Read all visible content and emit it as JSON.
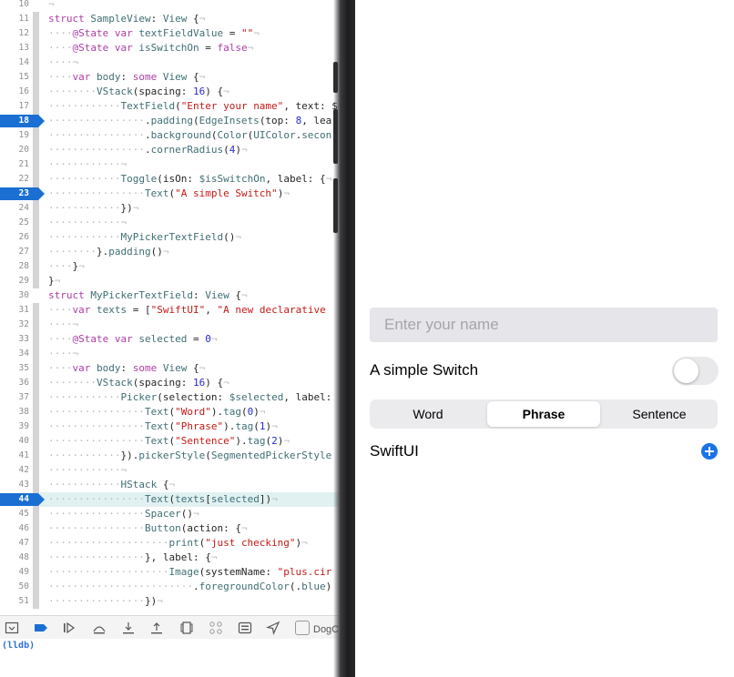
{
  "editor": {
    "lines": [
      {
        "num": "10",
        "html": "<span class='ws'>¬</span>"
      },
      {
        "num": "11",
        "html": "<span class='kw'>struct</span> <span class='ty'>SampleView</span>: <span class='ty'>View</span> {<span class='ws'>¬</span>"
      },
      {
        "num": "12",
        "html": "<span class='ws'>····</span><span class='kw'>@State</span> <span class='kw'>var</span> <span class='ty'>textFieldValue</span> = <span class='st'>\"\"</span><span class='ws'>¬</span>"
      },
      {
        "num": "13",
        "html": "<span class='ws'>····</span><span class='kw'>@State</span> <span class='kw'>var</span> <span class='ty'>isSwitchOn</span> = <span class='kw'>false</span><span class='ws'>¬</span>"
      },
      {
        "num": "14",
        "html": "<span class='ws'>····¬</span>"
      },
      {
        "num": "15",
        "html": "<span class='ws'>····</span><span class='kw'>var</span> <span class='ty'>body</span>: <span class='kw'>some</span> <span class='ty'>View</span> {<span class='ws'>¬</span>"
      },
      {
        "num": "16",
        "html": "<span class='ws'>········</span><span class='ty'>VStack</span>(spacing: <span class='nm'>16</span>) {<span class='ws'>¬</span>"
      },
      {
        "num": "17",
        "html": "<span class='ws'>············</span><span class='ty'>TextField</span>(<span class='st'>\"Enter your name\"</span>, text: $"
      },
      {
        "num": "18",
        "bp": true,
        "html": "<span class='ws'>················</span>.<span class='ty'>padding</span>(<span class='ty'>EdgeInsets</span>(top: <span class='nm'>8</span>, lea"
      },
      {
        "num": "19",
        "html": "<span class='ws'>················</span>.<span class='ty'>background</span>(<span class='ty'>Color</span>(<span class='ty'>UIColor</span>.<span class='ty'>secon</span>"
      },
      {
        "num": "20",
        "html": "<span class='ws'>················</span>.<span class='ty'>cornerRadius</span>(<span class='nm'>4</span>)<span class='ws'>¬</span>"
      },
      {
        "num": "21",
        "html": "<span class='ws'>············¬</span>"
      },
      {
        "num": "22",
        "html": "<span class='ws'>············</span><span class='ty'>Toggle</span>(isOn: <span class='ty'>$isSwitchOn</span>, label: {<span class='ws'>¬</span>"
      },
      {
        "num": "23",
        "bp": true,
        "html": "<span class='ws'>················</span><span class='ty'>Text</span>(<span class='st'>\"A simple Switch\"</span>)<span class='ws'>¬</span>"
      },
      {
        "num": "24",
        "html": "<span class='ws'>············</span>})<span class='ws'>¬</span>"
      },
      {
        "num": "25",
        "html": "<span class='ws'>············¬</span>"
      },
      {
        "num": "26",
        "html": "<span class='ws'>············</span><span class='ty'>MyPickerTextField</span>()<span class='ws'>¬</span>"
      },
      {
        "num": "27",
        "html": "<span class='ws'>········</span>}.<span class='ty'>padding</span>()<span class='ws'>¬</span>"
      },
      {
        "num": "28",
        "html": "<span class='ws'>····</span>}<span class='ws'>¬</span>"
      },
      {
        "num": "29",
        "html": "}<span class='ws'>¬</span>"
      },
      {
        "num": "30",
        "html": "<span class='kw'>struct</span> <span class='ty'>MyPickerTextField</span>: <span class='ty'>View</span> {<span class='ws'>¬</span>"
      },
      {
        "num": "31",
        "html": "<span class='ws'>····</span><span class='kw'>var</span> <span class='ty'>texts</span> = [<span class='st'>\"SwiftUI\"</span>, <span class='st'>\"A new declarative</span>"
      },
      {
        "num": "32",
        "html": "<span class='ws'>····¬</span>"
      },
      {
        "num": "33",
        "html": "<span class='ws'>····</span><span class='kw'>@State</span> <span class='kw'>var</span> <span class='ty'>selected</span> = <span class='nm'>0</span><span class='ws'>¬</span>"
      },
      {
        "num": "34",
        "html": "<span class='ws'>····¬</span>"
      },
      {
        "num": "35",
        "html": "<span class='ws'>····</span><span class='kw'>var</span> <span class='ty'>body</span>: <span class='kw'>some</span> <span class='ty'>View</span> {<span class='ws'>¬</span>"
      },
      {
        "num": "36",
        "html": "<span class='ws'>········</span><span class='ty'>VStack</span>(spacing: <span class='nm'>16</span>) {<span class='ws'>¬</span>"
      },
      {
        "num": "37",
        "html": "<span class='ws'>············</span><span class='ty'>Picker</span>(selection: <span class='ty'>$selected</span>, label:"
      },
      {
        "num": "38",
        "html": "<span class='ws'>················</span><span class='ty'>Text</span>(<span class='st'>\"Word\"</span>).<span class='ty'>tag</span>(<span class='nm'>0</span>)<span class='ws'>¬</span>"
      },
      {
        "num": "39",
        "html": "<span class='ws'>················</span><span class='ty'>Text</span>(<span class='st'>\"Phrase\"</span>).<span class='ty'>tag</span>(<span class='nm'>1</span>)<span class='ws'>¬</span>"
      },
      {
        "num": "40",
        "html": "<span class='ws'>················</span><span class='ty'>Text</span>(<span class='st'>\"Sentence\"</span>).<span class='ty'>tag</span>(<span class='nm'>2</span>)<span class='ws'>¬</span>"
      },
      {
        "num": "41",
        "html": "<span class='ws'>············</span>}).<span class='ty'>pickerStyle</span>(<span class='ty'>SegmentedPickerStyle</span>"
      },
      {
        "num": "42",
        "html": "<span class='ws'>············¬</span>"
      },
      {
        "num": "43",
        "html": "<span class='ws'>············</span><span class='ty'>HStack</span> {<span class='ws'>¬</span>"
      },
      {
        "num": "44",
        "bp": true,
        "current": true,
        "html": "<span class='ws'>················</span><span class='ty'>Text</span>(<span class='ty'>texts</span>[<span class='ty'>selected</span>])<span class='ws'>¬</span>"
      },
      {
        "num": "45",
        "html": "<span class='ws'>················</span><span class='ty'>Spacer</span>()<span class='ws'>¬</span>"
      },
      {
        "num": "46",
        "html": "<span class='ws'>················</span><span class='ty'>Button</span>(action: {<span class='ws'>¬</span>"
      },
      {
        "num": "47",
        "html": "<span class='ws'>····················</span><span class='ty'>print</span>(<span class='st'>\"just checking\"</span>)<span class='ws'>¬</span>"
      },
      {
        "num": "48",
        "html": "<span class='ws'>················</span>}, label: {<span class='ws'>¬</span>"
      },
      {
        "num": "49",
        "html": "<span class='ws'>····················</span><span class='ty'>Image</span>(systemName: <span class='st'>\"plus.cir</span>"
      },
      {
        "num": "50",
        "html": "<span class='ws'>························</span>.<span class='ty'>foregroundColor</span>(.<span class='ty'>blue</span>)"
      },
      {
        "num": "51",
        "html": "<span class='ws'>················</span>})<span class='ws'>¬</span>"
      }
    ],
    "fold_ranges": [
      [
        1,
        19
      ],
      [
        21,
        41
      ]
    ]
  },
  "debug_bar": {
    "buttons": [
      "hide-debug-area-icon",
      "breakpoints-toggle-icon",
      "continue-icon",
      "step-over-icon",
      "step-into-icon",
      "step-out-icon",
      "view-hierarchy-icon",
      "memory-graph-icon",
      "environment-overrides-icon",
      "simulate-location-icon"
    ],
    "app_name": "DogC"
  },
  "console": {
    "prompt": "(lldb)"
  },
  "simulator": {
    "text_field_placeholder": "Enter your name",
    "toggle_label": "A simple Switch",
    "toggle_on": false,
    "segments": [
      "Word",
      "Phrase",
      "Sentence"
    ],
    "selected_segment": 1,
    "selected_text": "SwiftUI"
  },
  "colors": {
    "breakpoint": "#1b6fd2",
    "keyword": "#ad3da4",
    "string": "#c41a16",
    "type": "#3f6e74",
    "accent": "#1a73e8"
  }
}
